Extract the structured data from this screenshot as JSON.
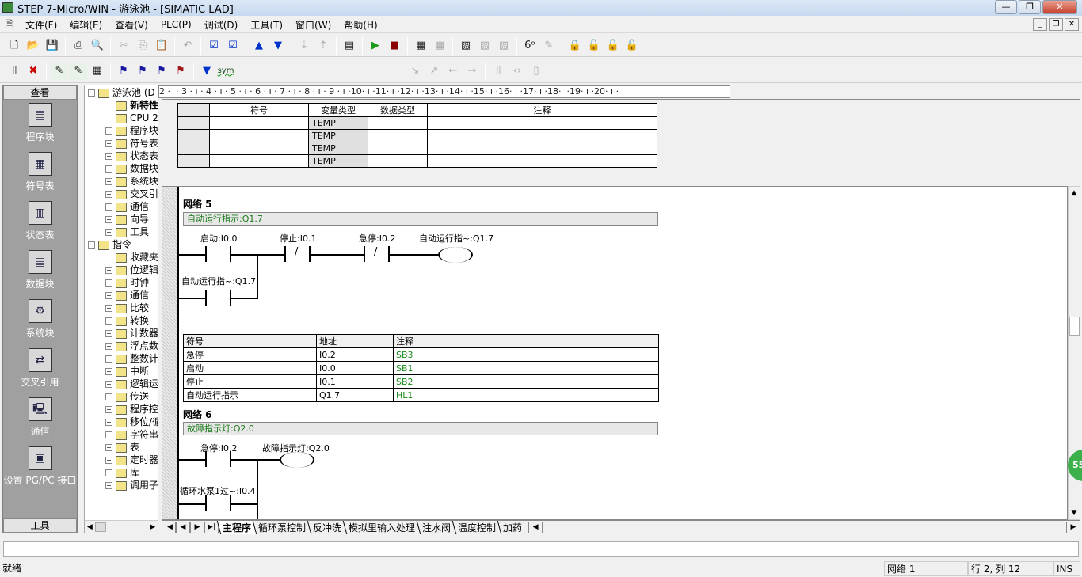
{
  "window": {
    "title": "STEP 7-Micro/WIN - 游泳池 - [SIMATIC LAD]",
    "min": "—",
    "max": "❐",
    "close": "✕"
  },
  "menu": [
    "文件(F)",
    "编辑(E)",
    "查看(V)",
    "PLC(P)",
    "调试(D)",
    "工具(T)",
    "窗口(W)",
    "帮助(H)"
  ],
  "mdi": {
    "min": "_",
    "restore": "❐",
    "close": "✕"
  },
  "toolbar1": [
    "new",
    "open",
    "save-all",
    "print",
    "print-preview",
    "cut",
    "copy",
    "paste",
    "undo",
    "compile",
    "compile-all",
    "upload",
    "download",
    "sort-asc",
    "sort-desc",
    "options",
    "run",
    "stop",
    "program-status",
    "chart-status",
    "trend",
    "status-table",
    "single-read",
    "write-all",
    "force",
    "unforce",
    "unforce-all",
    "read-all-forced"
  ],
  "toolbar2": [
    "insert-network",
    "delete-network",
    "toggle-poe",
    "toggle-comments",
    "toggle-symbol-table",
    "bookmark",
    "next-bookmark",
    "prev-bookmark",
    "remove-bookmarks",
    "apply-symbols",
    "symbol-info"
  ],
  "toolbar2_sym": "sym",
  "nav": {
    "header": "查看",
    "footer": "工具",
    "items": [
      "程序块",
      "符号表",
      "状态表",
      "数据块",
      "系统块",
      "交叉引用",
      "通信",
      "设置 PG/PC 接口"
    ]
  },
  "tree": {
    "items": [
      "游泳池 (D",
      "新特性",
      "CPU 2",
      "程序块",
      "符号表",
      "状态表",
      "数据块",
      "系统块",
      "交叉引",
      "通信",
      "向导",
      "工具",
      "指令",
      "收藏夹",
      "位逻辑",
      "时钟",
      "通信",
      "比较",
      "转换",
      "计数器",
      "浮点数",
      "整数计",
      "中断",
      "逻辑运",
      "传送",
      "程序控",
      "移位/循",
      "字符串",
      "表",
      "定时器",
      "库",
      "调用子"
    ]
  },
  "ruler": "2 ·  · 3 · ı · 4 · ı · 5 · ı · 6 · ı · 7 · ı · 8 · ı · 9 · ı ·10· ı ·11· ı ·12· ı ·13· ı ·14· ı ·15· ı ·16· ı ·17· ı ·18·  ·19· ı ·20· ı ·",
  "vartable": {
    "headers": [
      "符号",
      "变量类型",
      "数据类型",
      "注释"
    ],
    "rows": [
      [
        "",
        "TEMP",
        "",
        ""
      ],
      [
        "",
        "TEMP",
        "",
        ""
      ],
      [
        "",
        "TEMP",
        "",
        ""
      ],
      [
        "",
        "TEMP",
        "",
        ""
      ]
    ]
  },
  "network5": {
    "title": "网络 5",
    "comment": "自动运行指示:Q1.7",
    "contacts": [
      "启动:I0.0",
      "停止:I0.1",
      "急停:I0.2",
      "自动运行指~:Q1.7"
    ],
    "coil": "自动运行指~:Q1.7",
    "slash": "/",
    "symtable": {
      "headers": [
        "符号",
        "地址",
        "注释"
      ],
      "rows": [
        [
          "急停",
          "I0.2",
          "SB3"
        ],
        [
          "启动",
          "I0.0",
          "SB1"
        ],
        [
          "停止",
          "I0.1",
          "SB2"
        ],
        [
          "自动运行指示",
          "Q1.7",
          "HL1"
        ]
      ]
    }
  },
  "network6": {
    "title": "网络 6",
    "comment": "故障指示灯:Q2.0",
    "contacts": [
      "急停:I0.2",
      "循环水泵1过~:I0.4"
    ],
    "coil": "故障指示灯:Q2.0"
  },
  "tabs": [
    "主程序",
    "循环泵控制",
    "反冲洗",
    "模拟里输入处理",
    "注水阀",
    "温度控制",
    "加药"
  ],
  "tabnav": [
    "|◀",
    "◀",
    "▶",
    "▶|"
  ],
  "status": {
    "ready": "就绪",
    "network": "网络 1",
    "position": "行 2, 列 12",
    "mode": "INS"
  },
  "badge": "55"
}
